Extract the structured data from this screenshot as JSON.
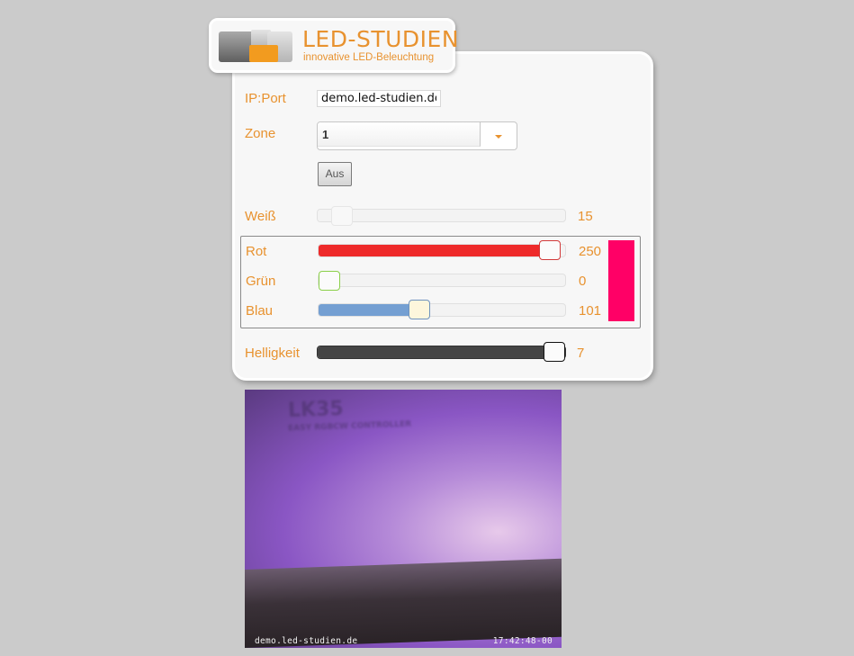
{
  "logo": {
    "title": "LED-STUDIEN",
    "subtitle": "innovative LED-Beleuchtung"
  },
  "form": {
    "ip_label": "IP:Port",
    "ip_value": "demo.led-studien.de",
    "zone_label": "Zone",
    "zone_value": "1",
    "off_button": "Aus"
  },
  "sliders": {
    "white": {
      "label": "Weiß",
      "value": "15",
      "level": 0.06,
      "fill_color": "#f3f3f3"
    },
    "red": {
      "label": "Rot",
      "value": "250",
      "level": 0.98,
      "fill_color": "#ee2a2a"
    },
    "green": {
      "label": "Grün",
      "value": "0",
      "level": 0.0,
      "fill_color": "#7ec23a"
    },
    "blue": {
      "label": "Blau",
      "value": "101",
      "level": 0.4,
      "fill_color": "#749fd2"
    },
    "brightness": {
      "label": "Helligkeit",
      "value": "7",
      "level": 1.0,
      "fill_color": "#444444"
    }
  },
  "color_preview": "#ff0066",
  "camera": {
    "overlay_left": "demo.led-studien.de",
    "overlay_right": "17:42:48-00",
    "device_label": "LK35",
    "device_sub": "EASY RGBCW CONTROLLER"
  },
  "colors": {
    "accent": "#e8922f",
    "background": "#cbcbcb",
    "panel": "#f7f7f7"
  }
}
